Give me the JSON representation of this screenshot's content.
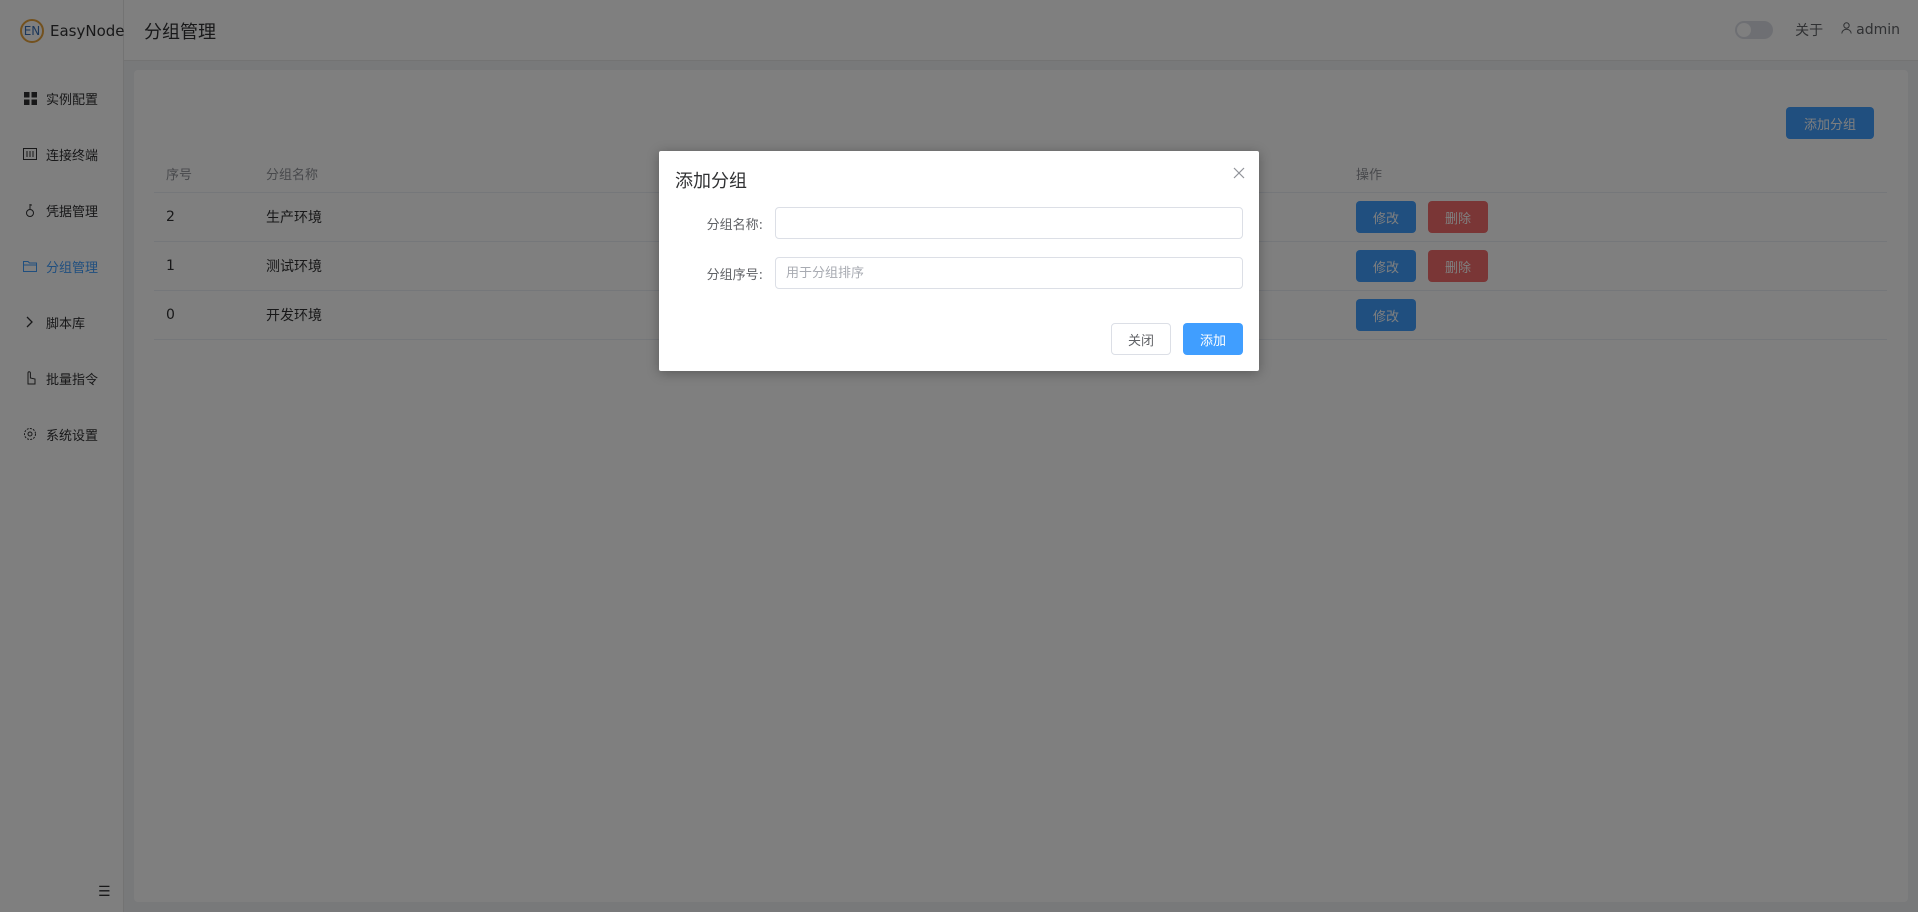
{
  "app": {
    "logo_text": "EN",
    "brand": "EasyNode"
  },
  "header": {
    "title": "分组管理",
    "about": "关于",
    "user": "admin"
  },
  "sidebar": {
    "items": [
      {
        "label": "实例配置",
        "icon": "grid-icon"
      },
      {
        "label": "连接终端",
        "icon": "terminal-icon"
      },
      {
        "label": "凭据管理",
        "icon": "key-icon"
      },
      {
        "label": "分组管理",
        "icon": "folder-icon",
        "active": true
      },
      {
        "label": "脚本库",
        "icon": "chevron-right-icon"
      },
      {
        "label": "批量指令",
        "icon": "pointer-icon"
      },
      {
        "label": "系统设置",
        "icon": "gear-icon"
      }
    ]
  },
  "main": {
    "add_button": "添加分组",
    "table": {
      "headers": {
        "index": "序号",
        "name": "分组名称",
        "actions": "操作"
      },
      "edit_label": "修改",
      "delete_label": "删除",
      "rows": [
        {
          "index": "2",
          "name": "生产环境",
          "deletable": true
        },
        {
          "index": "1",
          "name": "测试环境",
          "deletable": true
        },
        {
          "index": "0",
          "name": "开发环境",
          "deletable": false
        }
      ]
    }
  },
  "dialog": {
    "title": "添加分组",
    "name_label": "分组名称:",
    "name_value": "",
    "index_label": "分组序号:",
    "index_placeholder": "用于分组排序",
    "close_button": "关闭",
    "add_button": "添加"
  },
  "colors": {
    "primary": "#409eff",
    "danger": "#f56c6c",
    "logo_ring": "#e6a23c"
  }
}
